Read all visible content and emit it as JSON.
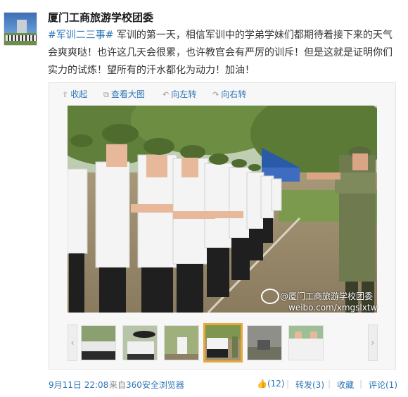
{
  "post": {
    "author": "厦门工商旅游学校团委",
    "topic": "#军训二三事#",
    "text": " 军训的第一天，相信军训中的学弟学妹们都期待着接下来的天气会爽爽哒！也许这几天会很累，也许教官会有严厉的训斥！但是这就是证明你们实力的试炼！望所有的汗水都化为动力！加油！"
  },
  "toolbar": {
    "collapse": "收起",
    "view_large": "查看大图",
    "rotate_left": "向左转",
    "rotate_right": "向右转"
  },
  "watermark": {
    "name": "@厦门工商旅游学校团委",
    "url": "weibo.com/xmgslxtw"
  },
  "thumbnails": {
    "count": 6,
    "selected_index": 3
  },
  "footer": {
    "time": "9月11日 22:08",
    "source_prefix": "来自",
    "source_link": "360安全浏览器",
    "like": "(12)",
    "repost": "转发(3)",
    "favorite": "收藏",
    "comment": "评论(1)",
    "sep": "|"
  },
  "colors": {
    "link": "#2e75b6",
    "thumb_selected_border": "#e8a93a"
  },
  "icons": [
    "collapse-icon",
    "zoom-icon",
    "rotate-left-icon",
    "rotate-right-icon",
    "weibo-icon",
    "like-icon"
  ]
}
